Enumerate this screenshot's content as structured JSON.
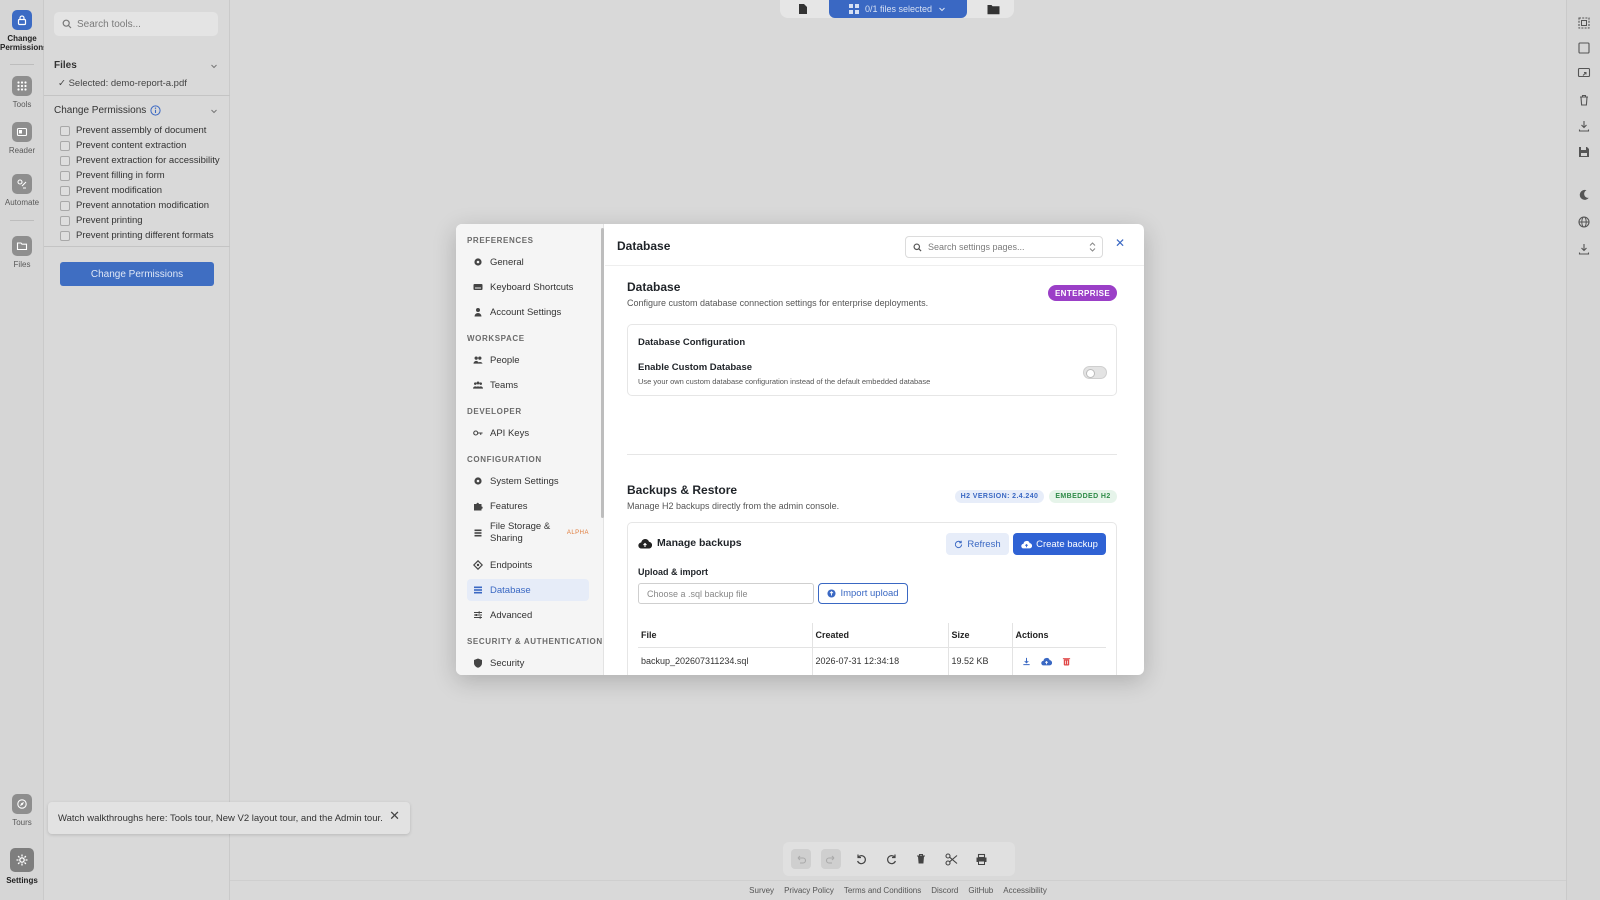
{
  "rail": {
    "items": [
      {
        "label": "Change Permissions",
        "icon": "lock-icon"
      },
      {
        "label": "Tools",
        "icon": "grid-icon"
      },
      {
        "label": "Reader",
        "icon": "book-icon"
      },
      {
        "label": "Automate",
        "icon": "automate-icon"
      },
      {
        "label": "Files",
        "icon": "folder-icon"
      },
      {
        "label": "Tours",
        "icon": "compass-icon"
      },
      {
        "label": "Settings",
        "icon": "gear-icon"
      }
    ]
  },
  "panel": {
    "search_placeholder": "Search tools...",
    "files_heading": "Files",
    "selected_file": "✓ Selected: demo-report-a.pdf",
    "permissions_heading": "Change Permissions",
    "permissions": [
      "Prevent assembly of document",
      "Prevent content extraction",
      "Prevent extraction for accessibility",
      "Prevent filling in form",
      "Prevent modification",
      "Prevent annotation modification",
      "Prevent printing",
      "Prevent printing different formats"
    ],
    "apply_button": "Change Permissions"
  },
  "topbar": {
    "files_selected": "0/1 files selected"
  },
  "toast": {
    "text": "Watch walkthroughs here: Tools tour, New V2 layout tour, and the Admin tour.",
    "close": "✕"
  },
  "footer": {
    "links": [
      "Survey",
      "Privacy Policy",
      "Terms and Conditions",
      "Discord",
      "GitHub",
      "Accessibility"
    ]
  },
  "modal": {
    "title": "Database",
    "search_placeholder": "Search settings pages...",
    "close": "✕",
    "nav": {
      "groups": {
        "preferences": "PREFERENCES",
        "workspace": "WORKSPACE",
        "developer": "DEVELOPER",
        "configuration": "CONFIGURATION",
        "security": "SECURITY & AUTHENTICATION"
      },
      "items": {
        "general": "General",
        "shortcuts": "Keyboard Shortcuts",
        "account": "Account Settings",
        "people": "People",
        "teams": "Teams",
        "api_keys": "API Keys",
        "system": "System Settings",
        "features": "Features",
        "storage": "File Storage & Sharing",
        "storage_badge": "ALPHA",
        "endpoints": "Endpoints",
        "database": "Database",
        "advanced": "Advanced",
        "security": "Security"
      }
    },
    "db": {
      "heading": "Database",
      "description": "Configure custom database connection settings for enterprise deployments.",
      "badge": "ENTERPRISE",
      "config_heading": "Database Configuration",
      "enable_label": "Enable Custom Database",
      "enable_desc": "Use your own custom database configuration instead of the default embedded database"
    },
    "backups": {
      "heading": "Backups & Restore",
      "description": "Manage H2 backups directly from the admin console.",
      "version_badge": "H2 VERSION: 2.4.240",
      "embedded_badge": "EMBEDDED H2",
      "manage_heading": "Manage backups",
      "refresh": "Refresh",
      "create": "Create backup",
      "upload_label": "Upload & import",
      "file_placeholder": "Choose a .sql backup file",
      "import": "Import upload",
      "columns": {
        "file": "File",
        "created": "Created",
        "size": "Size",
        "actions": "Actions"
      },
      "rows": [
        {
          "file": "backup_202607311234.sql",
          "created": "2026-07-31 12:34:18",
          "size": "19.52 KB"
        }
      ]
    }
  },
  "colors": {
    "accent": "#3a68c3",
    "enterprise": "#9b3fc7",
    "delete": "#e04848"
  }
}
